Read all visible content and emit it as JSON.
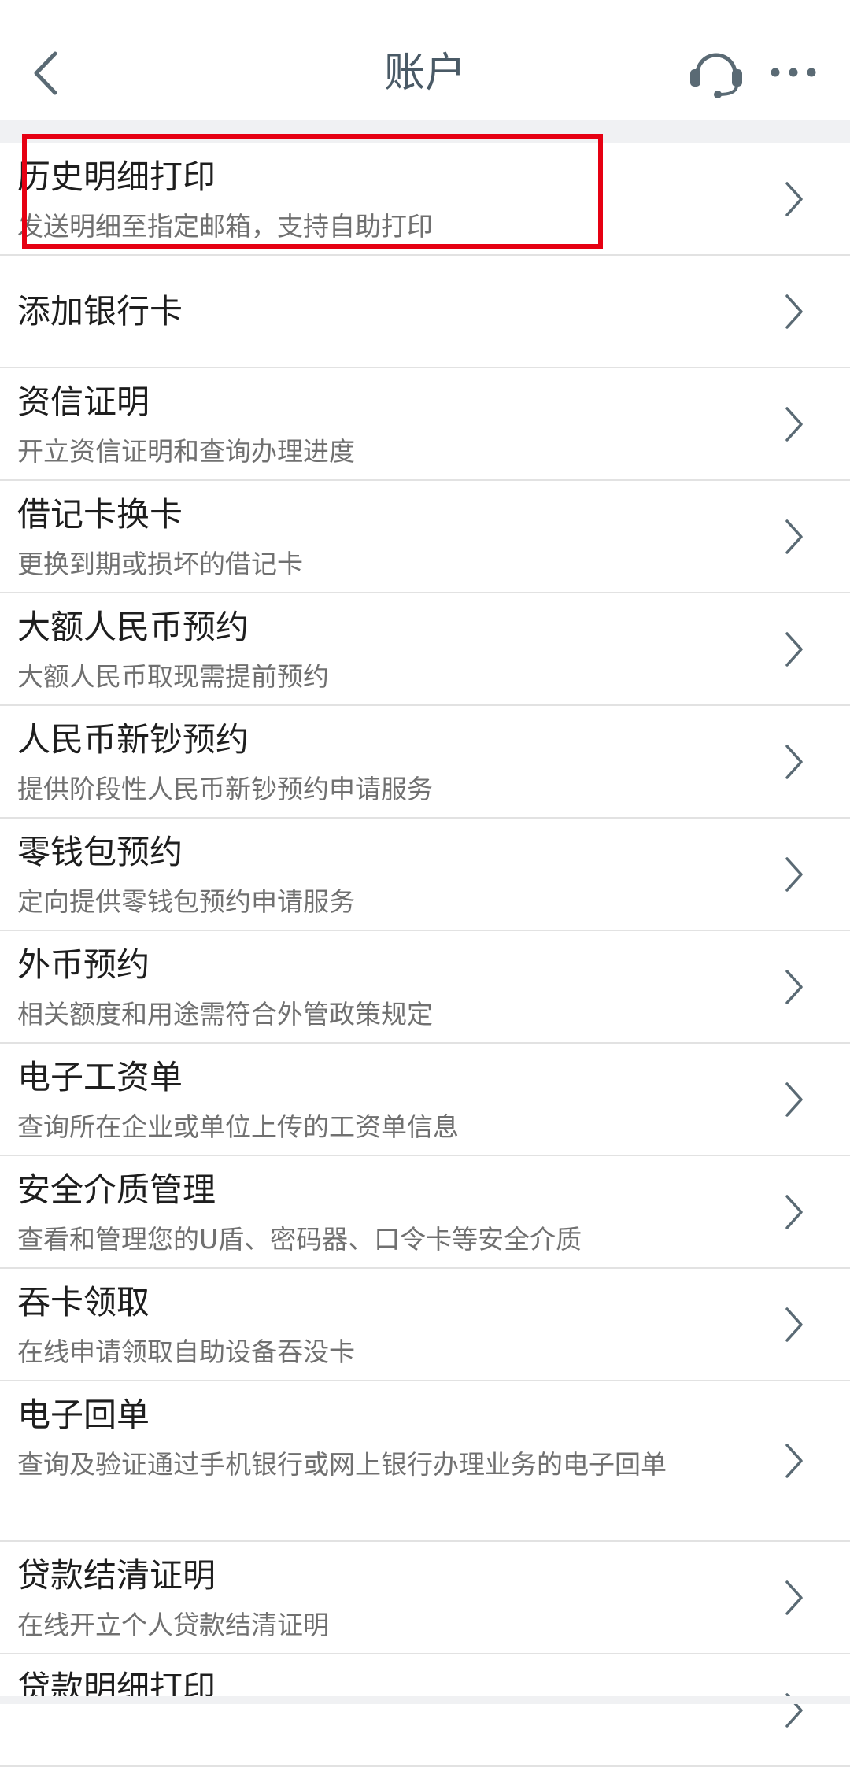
{
  "header": {
    "title": "账户",
    "back_icon": "chevron-left-icon",
    "service_icon": "headset-icon",
    "more_icon": "more-dots-icon"
  },
  "items": [
    {
      "title": "历史明细打印",
      "subtitle": "发送明细至指定邮箱，支持自助打印"
    },
    {
      "title": "添加银行卡",
      "subtitle": ""
    },
    {
      "title": "资信证明",
      "subtitle": "开立资信证明和查询办理进度"
    },
    {
      "title": "借记卡换卡",
      "subtitle": "更换到期或损坏的借记卡"
    },
    {
      "title": "大额人民币预约",
      "subtitle": "大额人民币取现需提前预约"
    },
    {
      "title": "人民币新钞预约",
      "subtitle": "提供阶段性人民币新钞预约申请服务"
    },
    {
      "title": "零钱包预约",
      "subtitle": "定向提供零钱包预约申请服务"
    },
    {
      "title": "外币预约",
      "subtitle": "相关额度和用途需符合外管政策规定"
    },
    {
      "title": "电子工资单",
      "subtitle": "查询所在企业或单位上传的工资单信息"
    },
    {
      "title": "安全介质管理",
      "subtitle": "查看和管理您的U盾、密码器、口令卡等安全介质"
    },
    {
      "title": "吞卡领取",
      "subtitle": "在线申请领取自助设备吞没卡"
    },
    {
      "title": "电子回单",
      "subtitle": "查询及验证通过手机银行或网上银行办理业务的电子回单"
    },
    {
      "title": "贷款结清证明",
      "subtitle": "在线开立个人贷款结清证明"
    },
    {
      "title": "贷款明细打印",
      "subtitle": ""
    }
  ],
  "colors": {
    "highlight_box": "#e60012",
    "title_text": "#4a5a66",
    "chevron": "#5a6a74"
  }
}
